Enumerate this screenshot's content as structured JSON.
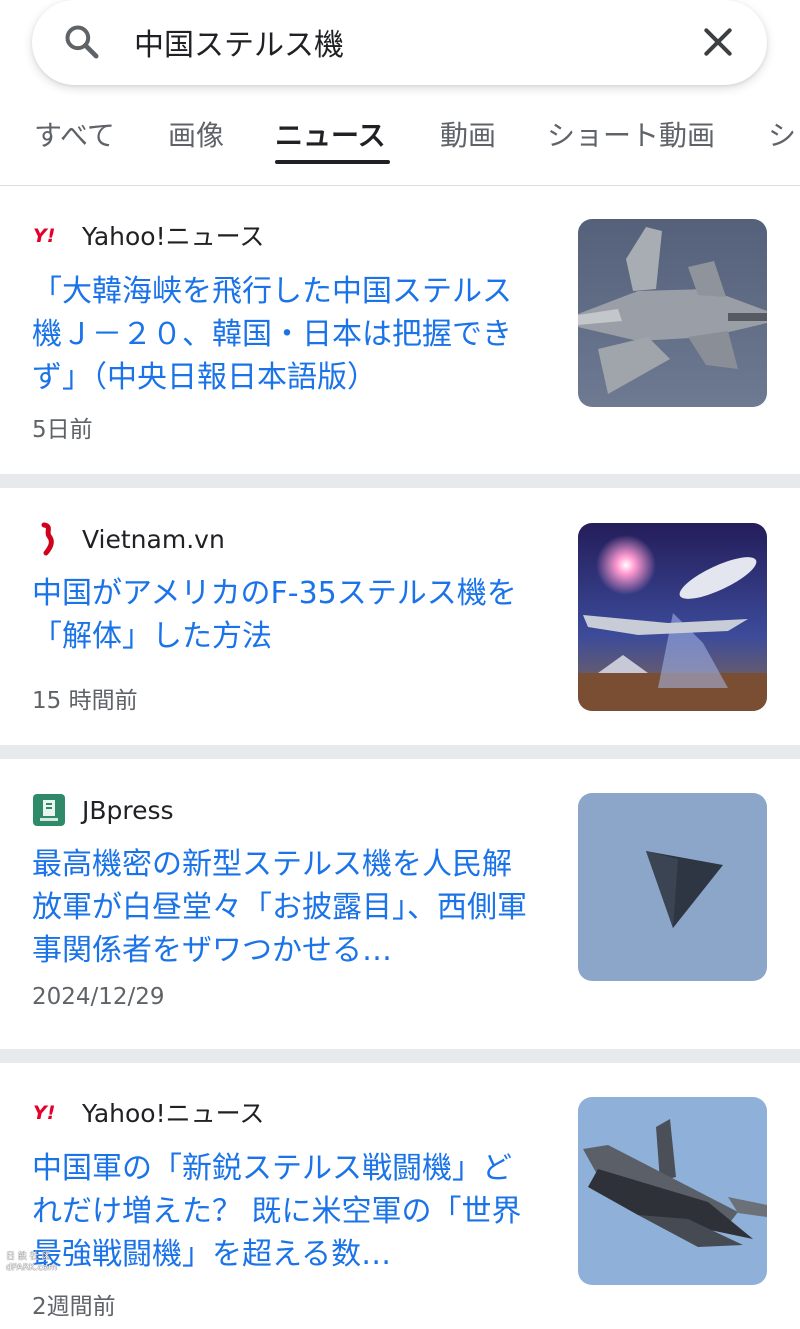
{
  "search": {
    "query": "中国ステルス機"
  },
  "tabs": [
    {
      "label": "すべて"
    },
    {
      "label": "画像"
    },
    {
      "label": "ニュース"
    },
    {
      "label": "動画"
    },
    {
      "label": "ショート動画"
    },
    {
      "label": "シ"
    }
  ],
  "active_tab": "ニュース",
  "results": [
    {
      "source": "Yahoo!ニュース",
      "logo_text": "Y!",
      "headline": "「大韓海峡を飛行した中国ステルス機Ｊ－２０、韓国・日本は把握できず」（中央日報日本語版）",
      "time": "5日前",
      "thumb": "fighter-jet-j20-image"
    },
    {
      "source": "Vietnam.vn",
      "headline": "中国がアメリカのF-35ステルス機を「解体」した方法",
      "time": "15 時間前",
      "thumb": "space-airship-illustration-image"
    },
    {
      "source": "JBpress",
      "headline": "最高機密の新型ステルス機を人民解放軍が白昼堂々「お披露目」、西側軍事関係者をザワつかせる…",
      "time": "2024/12/29",
      "thumb": "triangular-stealth-aircraft-image"
    },
    {
      "source": "Yahoo!ニュース",
      "logo_text": "Y!",
      "headline": "中国軍の「新鋭ステルス戦闘機」どれだけ増えた？ 既に米空軍の「世界最強戦闘機」を超える数…",
      "time": "2週間前",
      "thumb": "stealth-fighter-image"
    }
  ],
  "watermark": {
    "line1": "日 鉄 社 区",
    "line2": "dPARK.com"
  },
  "colors": {
    "link": "#1a73e8",
    "text": "#202124",
    "secondary": "#5f6368",
    "separator": "#e8e9ec",
    "yahoo_red": "#e4002b"
  }
}
